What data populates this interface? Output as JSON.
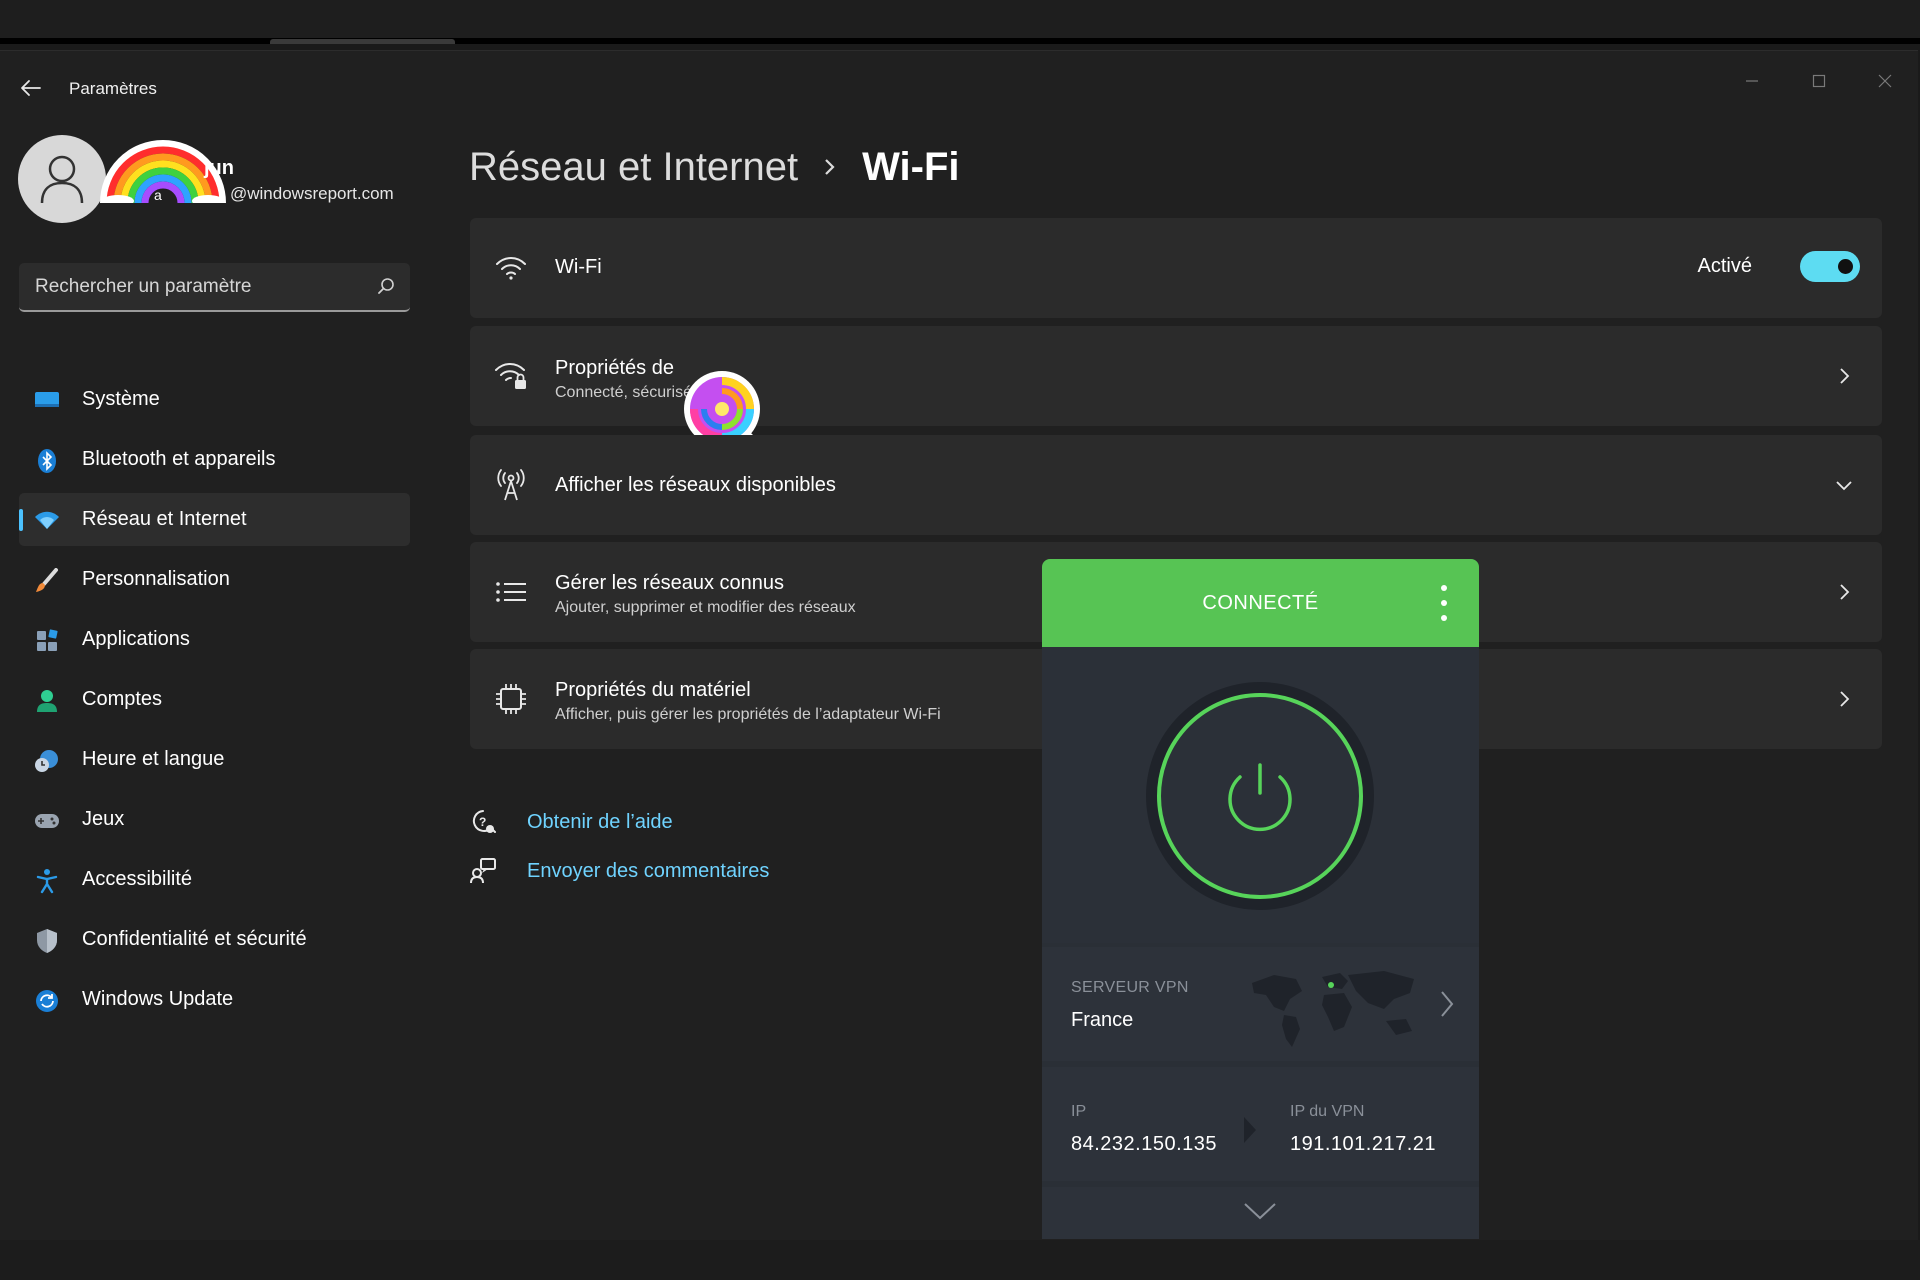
{
  "window": {
    "title": "Paramètres"
  },
  "profile": {
    "name": "jun",
    "email_prefix": "a",
    "email": "@windowsreport.com"
  },
  "search": {
    "placeholder": "Rechercher un paramètre"
  },
  "sidebar": {
    "items": [
      {
        "label": "Système",
        "icon": "monitor-icon",
        "active": false
      },
      {
        "label": "Bluetooth et appareils",
        "icon": "bluetooth-icon",
        "active": false
      },
      {
        "label": "Réseau et Internet",
        "icon": "wifi-icon",
        "active": true
      },
      {
        "label": "Personnalisation",
        "icon": "brush-icon",
        "active": false
      },
      {
        "label": "Applications",
        "icon": "apps-icon",
        "active": false
      },
      {
        "label": "Comptes",
        "icon": "person-icon",
        "active": false
      },
      {
        "label": "Heure et langue",
        "icon": "globe-clock-icon",
        "active": false
      },
      {
        "label": "Jeux",
        "icon": "gamepad-icon",
        "active": false
      },
      {
        "label": "Accessibilité",
        "icon": "accessibility-icon",
        "active": false
      },
      {
        "label": "Confidentialité et sécurité",
        "icon": "shield-icon",
        "active": false
      },
      {
        "label": "Windows Update",
        "icon": "update-icon",
        "active": false
      }
    ]
  },
  "breadcrumb": {
    "parent": "Réseau et Internet",
    "current": "Wi-Fi"
  },
  "cards": {
    "wifi": {
      "title": "Wi-Fi",
      "toggle_label": "Activé",
      "toggle_on": true
    },
    "properties": {
      "title": "Propriétés de ",
      "subtitle": "Connecté, sécurisé"
    },
    "available": {
      "title": "Afficher les réseaux disponibles"
    },
    "known": {
      "title": "Gérer les réseaux connus",
      "subtitle": "Ajouter, supprimer et modifier des réseaux"
    },
    "hardware": {
      "title": "Propriétés du matériel",
      "subtitle": "Afficher, puis gérer les propriétés de l’adaptateur Wi-Fi"
    }
  },
  "links": {
    "help": "Obtenir de l’aide",
    "feedback": "Envoyer des commentaires"
  },
  "vpn": {
    "status": "CONNECTÉ",
    "server_label": "SERVEUR VPN",
    "server_value": "France",
    "ip_label": "IP",
    "ip_value": "84.232.150.135",
    "vpn_ip_label": "IP du VPN",
    "vpn_ip_value": "191.101.217.21",
    "accent": "#57c454"
  },
  "colors": {
    "accent": "#4cc2ff",
    "toggle": "#5ddcf2",
    "link": "#6fd3ff"
  }
}
